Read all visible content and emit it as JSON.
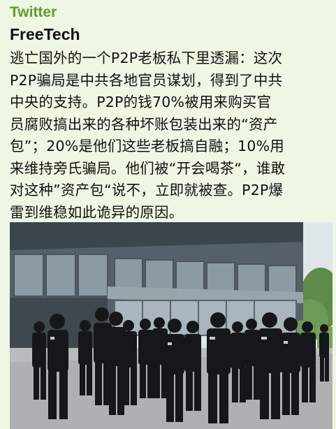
{
  "post": {
    "source": "Twitter",
    "author": "FreeTech",
    "lines": [
      "逃亡国外的一个P2P老板私下里透漏：这次",
      "P2P骗局是中共各地官员谋划，得到了中共",
      "中央的支持。P2P的钱70%被用来购买官",
      "员腐败搞出来的各种坏账包装出来的“资产",
      "包”；20%是他们这些老板搞自融；10%用",
      "来维持旁氏骗局。他们被“开会喝茶“，谁敢",
      "对这种”资产包“说不，立即就被查。P2P爆",
      "雷到维稳如此诡异的原因。"
    ]
  },
  "photo": {
    "icon": "photo-security-guards",
    "colors": {
      "sky": "#dfe6ea",
      "building": "#56606a",
      "glass": "#8c9aa3",
      "pavement": "#b9bcbd",
      "uniform": "#15171a",
      "tree": "#5f8a4a"
    }
  }
}
